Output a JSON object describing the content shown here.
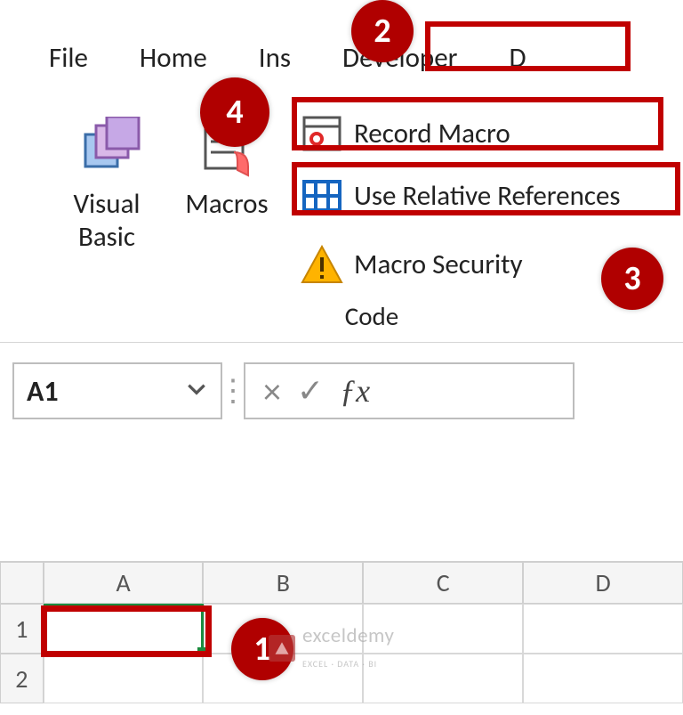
{
  "tabs": {
    "file": "File",
    "home": "Home",
    "insert_cut": "Ins",
    "developer": "Developer",
    "next_cut": "D"
  },
  "ribbon": {
    "visual_basic": {
      "line1": "Visual",
      "line2": "Basic"
    },
    "macros": "Macros",
    "record_macro": "Record Macro",
    "use_relative_refs": "Use Relative References",
    "macro_security": "Macro Security",
    "group_label": "Code"
  },
  "callouts": {
    "one": "1",
    "two": "2",
    "three": "3",
    "four": "4"
  },
  "namebox": {
    "value": "A1"
  },
  "formula_bar": {
    "fx": "ƒx",
    "value": ""
  },
  "grid": {
    "cols": [
      "A",
      "B",
      "C",
      "D"
    ],
    "rows": [
      "1",
      "2"
    ],
    "selected_cell": "A1"
  },
  "watermark": {
    "text": "exceldemy",
    "sub": "EXCEL · DATA · BI"
  }
}
